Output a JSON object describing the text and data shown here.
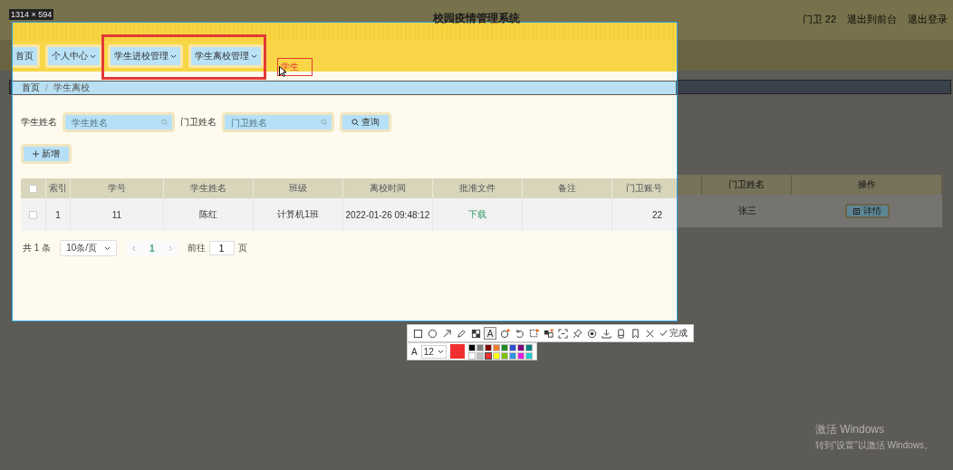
{
  "size_label": "1314 × 594",
  "header": {
    "title": "校园疫情管理系统",
    "user": "门卫 22",
    "links": [
      "退出到前台",
      "退出登录"
    ]
  },
  "nav": [
    {
      "label": "首页",
      "dropdown": false
    },
    {
      "label": "个人中心",
      "dropdown": true
    },
    {
      "label": "学生进校管理",
      "dropdown": true
    },
    {
      "label": "学生离校管理",
      "dropdown": true
    }
  ],
  "annotation_text": "学生",
  "breadcrumb": [
    "首页",
    "学生离校"
  ],
  "breadcrumb_separator": "/",
  "filters": [
    {
      "label": "学生姓名",
      "placeholder": "学生姓名"
    },
    {
      "label": "门卫姓名",
      "placeholder": "门卫姓名"
    }
  ],
  "search_button": "查询",
  "add_button": "新增",
  "table": {
    "select_all_checked": false,
    "columns": [
      "索引",
      "学号",
      "学生姓名",
      "班级",
      "离校时间",
      "批准文件",
      "备注",
      "门卫账号",
      "门卫姓名",
      "操作"
    ],
    "rows": [
      {
        "checked": false,
        "index": "1",
        "student_id": "11",
        "student_name": "陈红",
        "class": "计算机1班",
        "leave_time": "2022-01-26 09:48:12",
        "file_link": "下载",
        "guard_account": "22",
        "guard_name": "张三",
        "action": "详情"
      }
    ]
  },
  "pagination": {
    "total": "共 1 条",
    "page_size": "10条/页",
    "pages": [
      {
        "label": "1",
        "selected": true
      }
    ],
    "goto_label": "前往",
    "goto_value": "1",
    "goto_suffix": "页"
  },
  "snip_toolbar": {
    "tools": [
      {
        "kind": "rect",
        "selected": false
      },
      {
        "kind": "ellipse",
        "selected": false
      },
      {
        "kind": "arrow",
        "selected": false
      },
      {
        "kind": "pen",
        "selected": false
      },
      {
        "kind": "mosaic",
        "selected": false
      },
      {
        "kind": "text",
        "label": "A",
        "selected": true
      },
      {
        "kind": "number",
        "selected": false
      },
      {
        "kind": "undo",
        "selected": false
      },
      {
        "kind": "ocr",
        "selected": false
      },
      {
        "kind": "translate",
        "selected": false
      },
      {
        "kind": "scroll",
        "selected": false
      },
      {
        "kind": "pin",
        "selected": false
      },
      {
        "kind": "record",
        "selected": false
      },
      {
        "kind": "save",
        "selected": false
      },
      {
        "kind": "phone",
        "selected": false
      },
      {
        "kind": "bookmark",
        "selected": false
      },
      {
        "kind": "close",
        "selected": false
      }
    ],
    "done_label": "完成",
    "font_label": "A",
    "font_size": "12",
    "palette": [
      {
        "color": "#000000",
        "selected": false
      },
      {
        "color": "#808080",
        "selected": false
      },
      {
        "color": "#800000",
        "selected": false
      },
      {
        "color": "#f08030",
        "selected": false
      },
      {
        "color": "#228b22",
        "selected": false
      },
      {
        "color": "#3050d0",
        "selected": false
      },
      {
        "color": "#800080",
        "selected": false
      },
      {
        "color": "#008080",
        "selected": false
      },
      {
        "color": "#ffffff",
        "selected": false
      },
      {
        "color": "#c0c0c0",
        "selected": false
      },
      {
        "color": "#f03030",
        "selected": true
      },
      {
        "color": "#ffff00",
        "selected": false
      },
      {
        "color": "#80c000",
        "selected": false
      },
      {
        "color": "#3090e0",
        "selected": false
      },
      {
        "color": "#e020e0",
        "selected": false
      },
      {
        "color": "#20d0d0",
        "selected": false
      }
    ]
  },
  "os_notice": {
    "title": "激活 Windows",
    "text": "转到“设置”以激活 Windows。"
  }
}
